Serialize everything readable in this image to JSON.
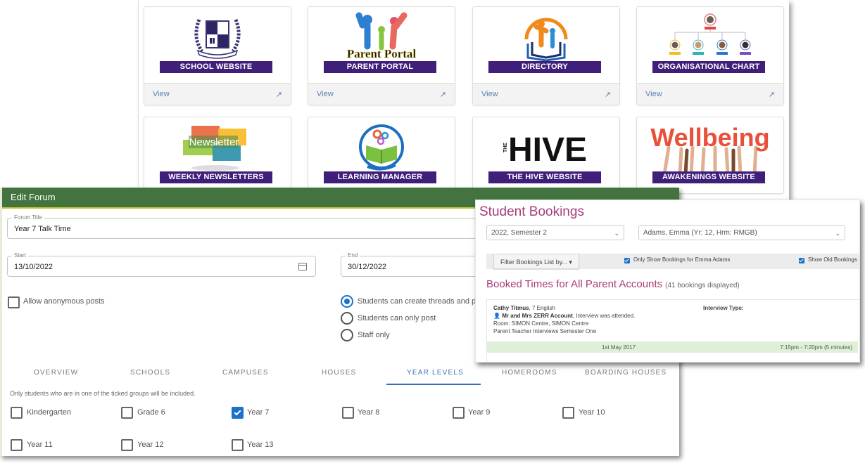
{
  "portal": {
    "tiles": [
      {
        "label": "SCHOOL WEBSITE",
        "icon": "school-crest-logo",
        "view": "View"
      },
      {
        "label": "PARENT PORTAL",
        "icon": "parent-portal-logo",
        "logo_text": "Parent Portal",
        "view": "View"
      },
      {
        "label": "DIRECTORY",
        "icon": "directory-book-logo",
        "view": "View"
      },
      {
        "label": "ORGANISATIONAL CHART",
        "icon": "org-chart-logo",
        "view": "View"
      },
      {
        "label": "WEEKLY NEWSLETTERS",
        "icon": "newsletter-logo",
        "logo_text": "Newsletter"
      },
      {
        "label": "LEARNING MANAGER",
        "icon": "learning-manager-logo"
      },
      {
        "label": "THE HIVE WEBSITE",
        "icon": "hive-logo",
        "logo_text": "HIVE",
        "logo_small": "THE"
      },
      {
        "label": "AWAKENINGS WEBSITE",
        "icon": "wellbeing-logo",
        "logo_text": "Wellbeing"
      }
    ],
    "external_link_icon": "↗"
  },
  "forum": {
    "title": "Edit Forum",
    "forum_title_label": "Forum Title",
    "forum_title_value": "Year 7 Talk Time",
    "start_label": "Start",
    "start_value": "13/10/2022",
    "end_label": "End",
    "end_value": "30/12/2022",
    "anonymous_label": "Allow anonymous posts",
    "anonymous_checked": false,
    "permissions": [
      {
        "label": "Students can create threads and pos",
        "selected": true
      },
      {
        "label": "Students can only post",
        "selected": false
      },
      {
        "label": "Staff only",
        "selected": false
      }
    ],
    "tabs": [
      "OVERVIEW",
      "SCHOOLS",
      "CAMPUSES",
      "HOUSES",
      "YEAR LEVELS",
      "HOMEROOMS",
      "BOARDING HOUSES"
    ],
    "active_tab": "YEAR LEVELS",
    "help_text": "Only students who are in one of the ticked groups will be included.",
    "year_levels": [
      {
        "label": "Kindergarten",
        "checked": false
      },
      {
        "label": "Grade 6",
        "checked": false
      },
      {
        "label": "Year 7",
        "checked": true
      },
      {
        "label": "Year 8",
        "checked": false
      },
      {
        "label": "Year 9",
        "checked": false
      },
      {
        "label": "Year 10",
        "checked": false
      },
      {
        "label": "Year 11",
        "checked": false
      },
      {
        "label": "Year 12",
        "checked": false
      },
      {
        "label": "Year 13",
        "checked": false
      }
    ]
  },
  "bookings": {
    "title": "Student Bookings",
    "semester_select": "2022, Semester 2",
    "student_select": "Adams, Emma (Yr: 12, Hrm: RMGB)",
    "filter_button": "Filter Bookings List by... ▾",
    "only_show_label": "Only Show Bookings for Emma Adams",
    "show_old_label": "Show Old Bookings",
    "booked_heading": "Booked Times for All Parent Accounts",
    "booked_count": "(41 bookings displayed)",
    "entry": {
      "teacher": "Cathy Titmus",
      "subject": ", 7 English",
      "parent": "Mr and Mrs ZERR Account",
      "status": ", Interview was attended.",
      "room": "Room: SIMON Centre, SIMON Centre",
      "event": "Parent Teacher Interviews Semester One",
      "interview_type_label": "Interview Type:",
      "date": "1st May 2017",
      "time": "7:15pm - 7:20pm (5 minutes)"
    }
  }
}
